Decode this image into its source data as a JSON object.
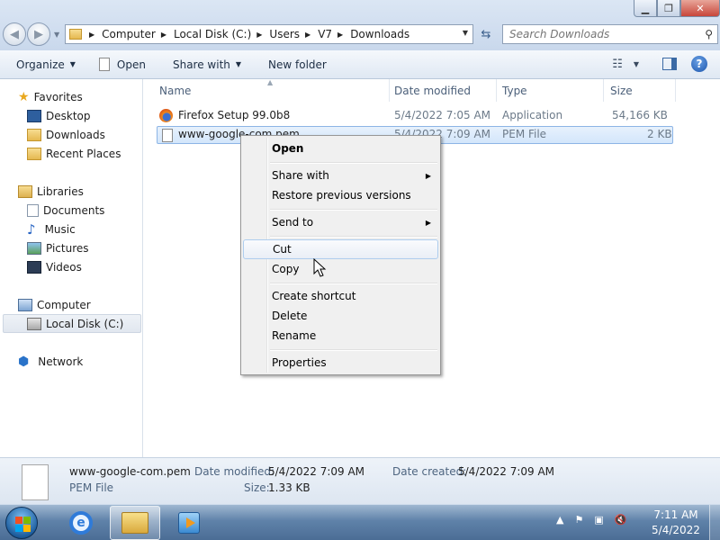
{
  "window": {
    "minimize": "▁",
    "maximize": "❐",
    "close": "✕"
  },
  "address": {
    "crumbs": [
      "Computer",
      "Local Disk (C:)",
      "Users",
      "V7",
      "Downloads"
    ]
  },
  "search": {
    "placeholder": "Search Downloads"
  },
  "toolbar": {
    "organize": "Organize",
    "open": "Open",
    "share_with": "Share with",
    "new_folder": "New folder"
  },
  "nav": {
    "favorites": "Favorites",
    "desktop": "Desktop",
    "downloads": "Downloads",
    "recent_places": "Recent Places",
    "libraries": "Libraries",
    "documents": "Documents",
    "music": "Music",
    "pictures": "Pictures",
    "videos": "Videos",
    "computer": "Computer",
    "local_disk": "Local Disk (C:)",
    "network": "Network"
  },
  "columns": {
    "name": "Name",
    "date_modified": "Date modified",
    "type": "Type",
    "size": "Size"
  },
  "files": [
    {
      "name": "Firefox Setup 99.0b8",
      "date": "5/4/2022 7:05 AM",
      "type": "Application",
      "size": "54,166 KB",
      "icon": "firefox-icon"
    },
    {
      "name": "www-google-com.pem",
      "date": "5/4/2022 7:09 AM",
      "type": "PEM File",
      "size": "2 KB",
      "icon": "pem-file-icon"
    }
  ],
  "context_menu": {
    "open": "Open",
    "share_with": "Share with",
    "restore": "Restore previous versions",
    "send_to": "Send to",
    "cut": "Cut",
    "copy": "Copy",
    "create_shortcut": "Create shortcut",
    "delete": "Delete",
    "rename": "Rename",
    "properties": "Properties"
  },
  "details": {
    "name": "www-google-com.pem",
    "type": "PEM File",
    "date_modified_label": "Date modified:",
    "date_modified": "5/4/2022 7:09 AM",
    "date_created_label": "Date created:",
    "date_created": "5/4/2022 7:09 AM",
    "size_label": "Size:",
    "size": "1.33 KB"
  },
  "taskbar": {
    "clock_time": "7:11 AM",
    "clock_date": "5/4/2022"
  },
  "colors": {
    "selection": "#d3e6fb",
    "taskbar": "#4b6d95",
    "accent": "#3b6aa5"
  }
}
